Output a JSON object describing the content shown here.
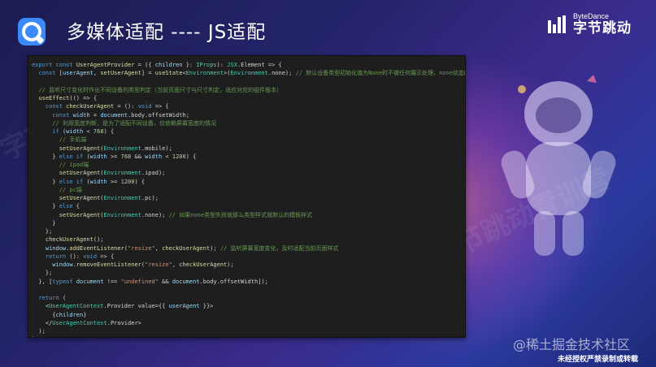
{
  "header": {
    "title": "多媒体适配 ---- JS适配",
    "brand_en": "ByteDance",
    "brand_cn": "字节跳动"
  },
  "code_lines": [
    "export const UserAgentProvider = ({ children }: IProps): JSX.Element => {",
    "  const [userAgent, setUserAgent] = useState<Environment>(Environment.none); // 默认设备类型初始化值为None时不做任何展示处理，none状态时展示空",
    "",
    "  // 监听尺寸变化时作出不同设备的类型判定（当前页面尺寸与尺寸判定，适应对应的组件版本）",
    "  useEffect(() => {",
    "    const checkUserAgent = (): void => {",
    "      const width = document.body.offsetWidth;",
    "      // 利用宽度判断，是为了适配不同设备，仅依赖屏幕宽度的情况",
    "      if (width < 768) {",
    "        // 手机端",
    "        setUserAgent(Environment.mobile);",
    "      } else if (width >= 768 && width < 1200) {",
    "        // ipad端",
    "        setUserAgent(Environment.ipad);",
    "      } else if (width >= 1200) {",
    "        // pc端",
    "        setUserAgent(Environment.pc);",
    "      } else {",
    "        setUserAgent(Environment.none); // 如果none类型失败就那么类型样式就默认的模板样式",
    "      }",
    "    };",
    "    checkUserAgent();",
    "    window.addEventListener(\"resize\", checkUserAgent); // 监听屏幕宽度变化，及时适配当前页面样式",
    "    return (): void => {",
    "      window.removeEventListener(\"resize\", checkUserAgent);",
    "    };",
    "  }, [typeof document !== \"undefined\" && document.body.offsetWidth]);",
    "",
    "  return (",
    "    <UserAgentContext.Provider value={{ userAgent }}>",
    "      {children}",
    "    </UserAgentContext.Provider>",
    "  );",
    "};"
  ],
  "footer": {
    "site": "@稀土掘金技术社区",
    "note": "未经授权严禁录制或转载"
  },
  "watermarks": [
    "字节跳动青训营",
    "字节跳动青训营",
    "字节跳动青训营"
  ],
  "colors": {
    "background": "#24246a",
    "editor_bg": "#1e1e1e",
    "accent": "#3b8bff"
  },
  "icons": {
    "app_logo": "rounded-q-logo-icon",
    "brand_logo": "bytedance-bars-icon"
  }
}
